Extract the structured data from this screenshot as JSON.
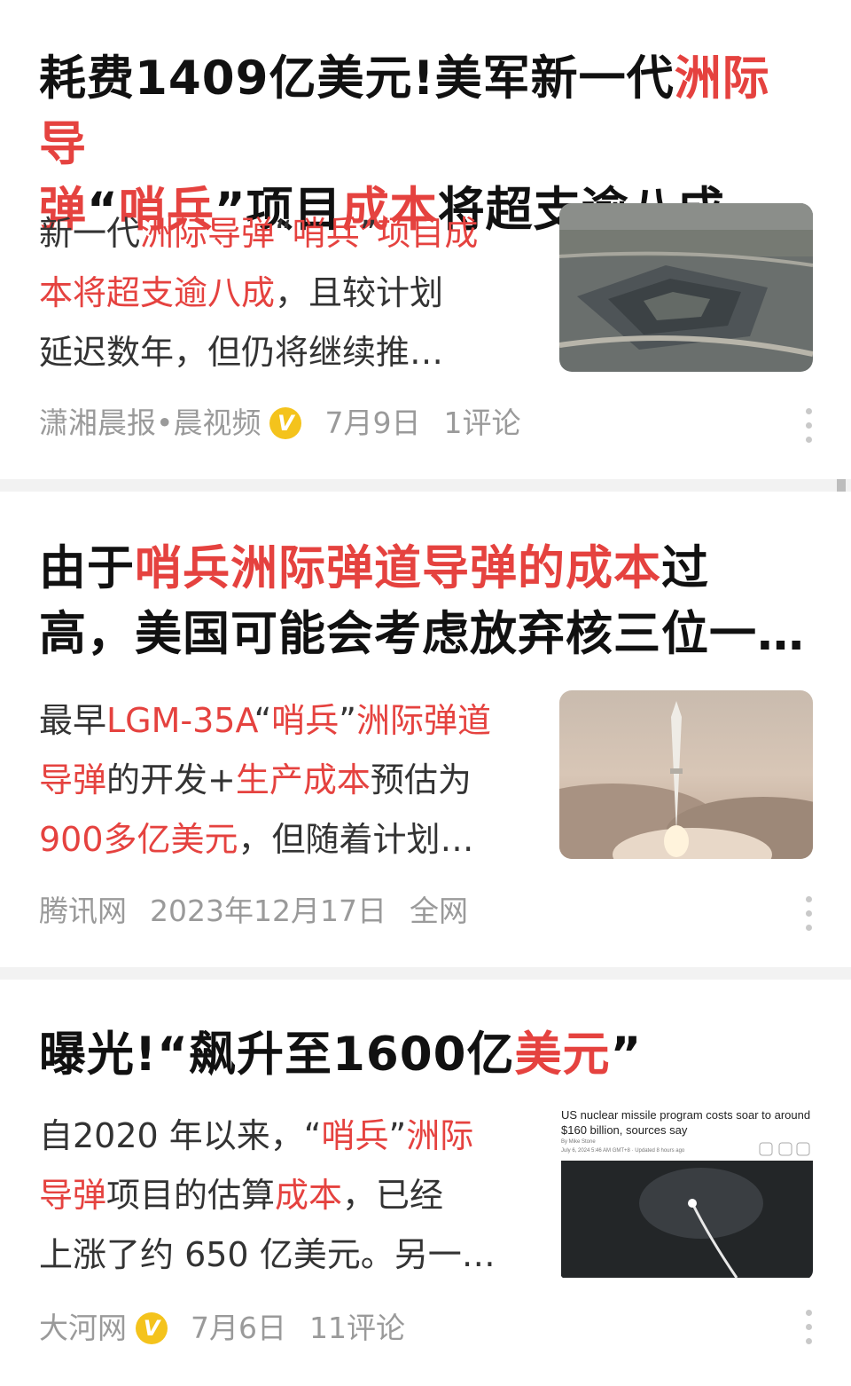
{
  "articles": [
    {
      "title_lines": [
        [
          {
            "t": "耗费1409亿美元!美军新一代"
          },
          {
            "t": "洲际导",
            "h": true
          }
        ],
        [
          {
            "t": "弹",
            "h": true
          },
          {
            "t": "“"
          },
          {
            "t": "哨兵",
            "h": true
          },
          {
            "t": "”项目"
          },
          {
            "t": "成本",
            "h": true
          },
          {
            "t": "将超支逾八成"
          }
        ]
      ],
      "summary_lines": [
        [
          {
            "t": "新一代"
          },
          {
            "t": "洲际导弹",
            "h": true
          },
          {
            "t": "“"
          },
          {
            "t": "哨兵",
            "h": true
          },
          {
            "t": "”"
          },
          {
            "t": "项目成",
            "h": true
          }
        ],
        [
          {
            "t": "本将超支逾八成",
            "h": true
          },
          {
            "t": "，且较计划"
          }
        ],
        [
          {
            "t": "延迟数年，但仍将继续推…"
          }
        ]
      ],
      "source": "潇湘晨报•晨视频",
      "verified_badge": "V",
      "date": "7月9日",
      "comments": "1评论",
      "thumb_icon": "pentagon-aerial-photo"
    },
    {
      "title_lines": [
        [
          {
            "t": "由于"
          },
          {
            "t": "哨兵洲际弹道导弹的成本",
            "h": true
          },
          {
            "t": "过"
          }
        ],
        [
          {
            "t": "高，美国可能会考虑放弃核三位一…"
          }
        ]
      ],
      "summary_lines": [
        [
          {
            "t": "最早"
          },
          {
            "t": "LGM-35A",
            "h": true
          },
          {
            "t": "“"
          },
          {
            "t": "哨兵",
            "h": true
          },
          {
            "t": "”"
          },
          {
            "t": "洲际弹道",
            "h": true
          }
        ],
        [
          {
            "t": "导弹",
            "h": true
          },
          {
            "t": "的开发+"
          },
          {
            "t": "生产成本",
            "h": true
          },
          {
            "t": "预估为"
          }
        ],
        [
          {
            "t": "900多亿美元",
            "h": true
          },
          {
            "t": "，但随着计划…"
          }
        ]
      ],
      "source": "腾讯网",
      "date": "2023年12月17日",
      "comments": "全网",
      "thumb_icon": "missile-launch-photo"
    },
    {
      "title_lines": [
        [
          {
            "t": "曝光!“飙升至1600亿"
          },
          {
            "t": "美元",
            "h": true
          },
          {
            "t": "”"
          }
        ]
      ],
      "summary_lines": [
        [
          {
            "t": "自2020 年以来，“"
          },
          {
            "t": "哨兵",
            "h": true
          },
          {
            "t": "”"
          },
          {
            "t": "洲际",
            "h": true
          }
        ],
        [
          {
            "t": "导弹",
            "h": true
          },
          {
            "t": "项目的估算"
          },
          {
            "t": "成本",
            "h": true
          },
          {
            "t": "，已经"
          }
        ],
        [
          {
            "t": "上涨了约 650 亿美元。另一…"
          }
        ]
      ],
      "source": "大河网",
      "verified_badge": "V",
      "date": "7月6日",
      "comments": "11评论",
      "thumb_icon": "news-screenshot-missile",
      "thumb_headline": "US nuclear missile program costs soar to around $160 billion, sources say",
      "thumb_byline": "By Mike Stone",
      "thumb_dateline": "July 6, 2024 5:46 AM GMT+8 · Updated 8 hours ago"
    }
  ],
  "colors": {
    "highlight": "#e5423f",
    "text": "#111111",
    "meta": "#9a9a9a",
    "badge": "#f4c31c"
  }
}
